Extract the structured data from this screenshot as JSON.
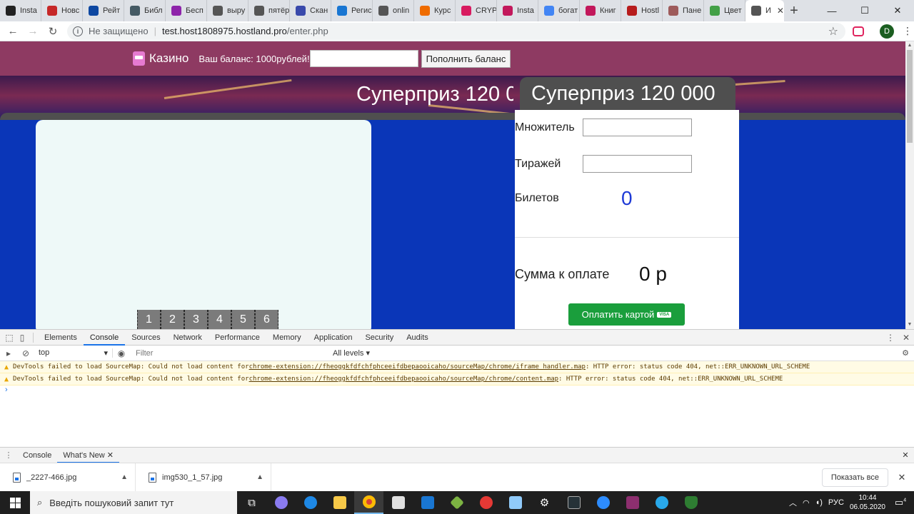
{
  "browser": {
    "tabs": [
      {
        "label": "Insta",
        "color": "#222222"
      },
      {
        "label": "Новс",
        "color": "#c62828"
      },
      {
        "label": "Рейт",
        "color": "#0d47a1"
      },
      {
        "label": "Библ",
        "color": "#455a64"
      },
      {
        "label": "Бесп",
        "color": "#8e24aa"
      },
      {
        "label": "выру",
        "color": "#555555"
      },
      {
        "label": "пятёр",
        "color": "#555555"
      },
      {
        "label": "Скан",
        "color": "#3949ab"
      },
      {
        "label": "Регис",
        "color": "#1976d2"
      },
      {
        "label": "onlin",
        "color": "#555555"
      },
      {
        "label": "Курс",
        "color": "#ef6c00"
      },
      {
        "label": "CRYP",
        "color": "#d81b60"
      },
      {
        "label": "Insta",
        "color": "#c2185b"
      },
      {
        "label": "богат",
        "color": "#4285f4"
      },
      {
        "label": "Книг",
        "color": "#c2185b"
      },
      {
        "label": "Hostl",
        "color": "#b71c1c"
      },
      {
        "label": "Пане",
        "color": "#9e5b5b"
      },
      {
        "label": "Цвет",
        "color": "#43a047"
      }
    ],
    "active_tab": {
      "label": "И",
      "close": "✕"
    },
    "new_tab": "+",
    "window_controls": {
      "minimize": "—",
      "maximize": "☐",
      "close": "✕"
    },
    "address": {
      "security": "Не защищено",
      "host": "test.host1808975.hostland.pro",
      "path": "/enter.php"
    },
    "profile_initial": "D"
  },
  "site": {
    "logo_text": "Казино",
    "balance_text": "Ваш баланс: 1000рублей!",
    "topup_button": "Пополнить баланс",
    "prize_left": "Суперприз 120 0",
    "prize_right": "Суперприз 120 000",
    "number_tabs": [
      "1",
      "2",
      "3",
      "4",
      "5",
      "6"
    ],
    "multiplier_label": "Множитель",
    "draws_label": "Тиражей",
    "tickets_label": "Билетов",
    "tickets_value": "0",
    "sum_label": "Сумма к оплате",
    "sum_value": "0 р",
    "pay_button": "Оплатить картой",
    "pay_badge": "VISA",
    "colors": {
      "header": "#8e3a62",
      "page_bg": "#0a36b8",
      "pay": "#1a9e3c"
    }
  },
  "devtools": {
    "tabs": [
      "Elements",
      "Console",
      "Sources",
      "Network",
      "Performance",
      "Memory",
      "Application",
      "Security",
      "Audits"
    ],
    "active_tab": "Console",
    "context": "top",
    "filter_placeholder": "Filter",
    "levels": "All levels ▾",
    "messages": [
      {
        "prefix": "DevTools failed to load SourceMap: Could not load content for ",
        "link": "chrome-extension://fheoggkfdfchfphceeifdbepaooicaho/sourceMap/chrome/iframe_handler.map",
        "suffix": ": HTTP error: status code 404, net::ERR_UNKNOWN_URL_SCHEME"
      },
      {
        "prefix": "DevTools failed to load SourceMap: Could not load content for ",
        "link": "chrome-extension://fheoggkfdfchfphceeifdbepaooicaho/sourceMap/chrome/content.map",
        "suffix": ": HTTP error: status code 404, net::ERR_UNKNOWN_URL_SCHEME"
      }
    ],
    "drawer_tabs": [
      "Console",
      "What's New"
    ],
    "drawer_active": "What's New"
  },
  "downloads": {
    "files": [
      "_2227-466.jpg",
      "img530_1_57.jpg"
    ],
    "show_all": "Показать все"
  },
  "taskbar": {
    "search_placeholder": "Введіть пошуковий запит тут",
    "language": "РУС",
    "time": "10:44",
    "date": "06.05.2020",
    "notification_count": "4"
  }
}
